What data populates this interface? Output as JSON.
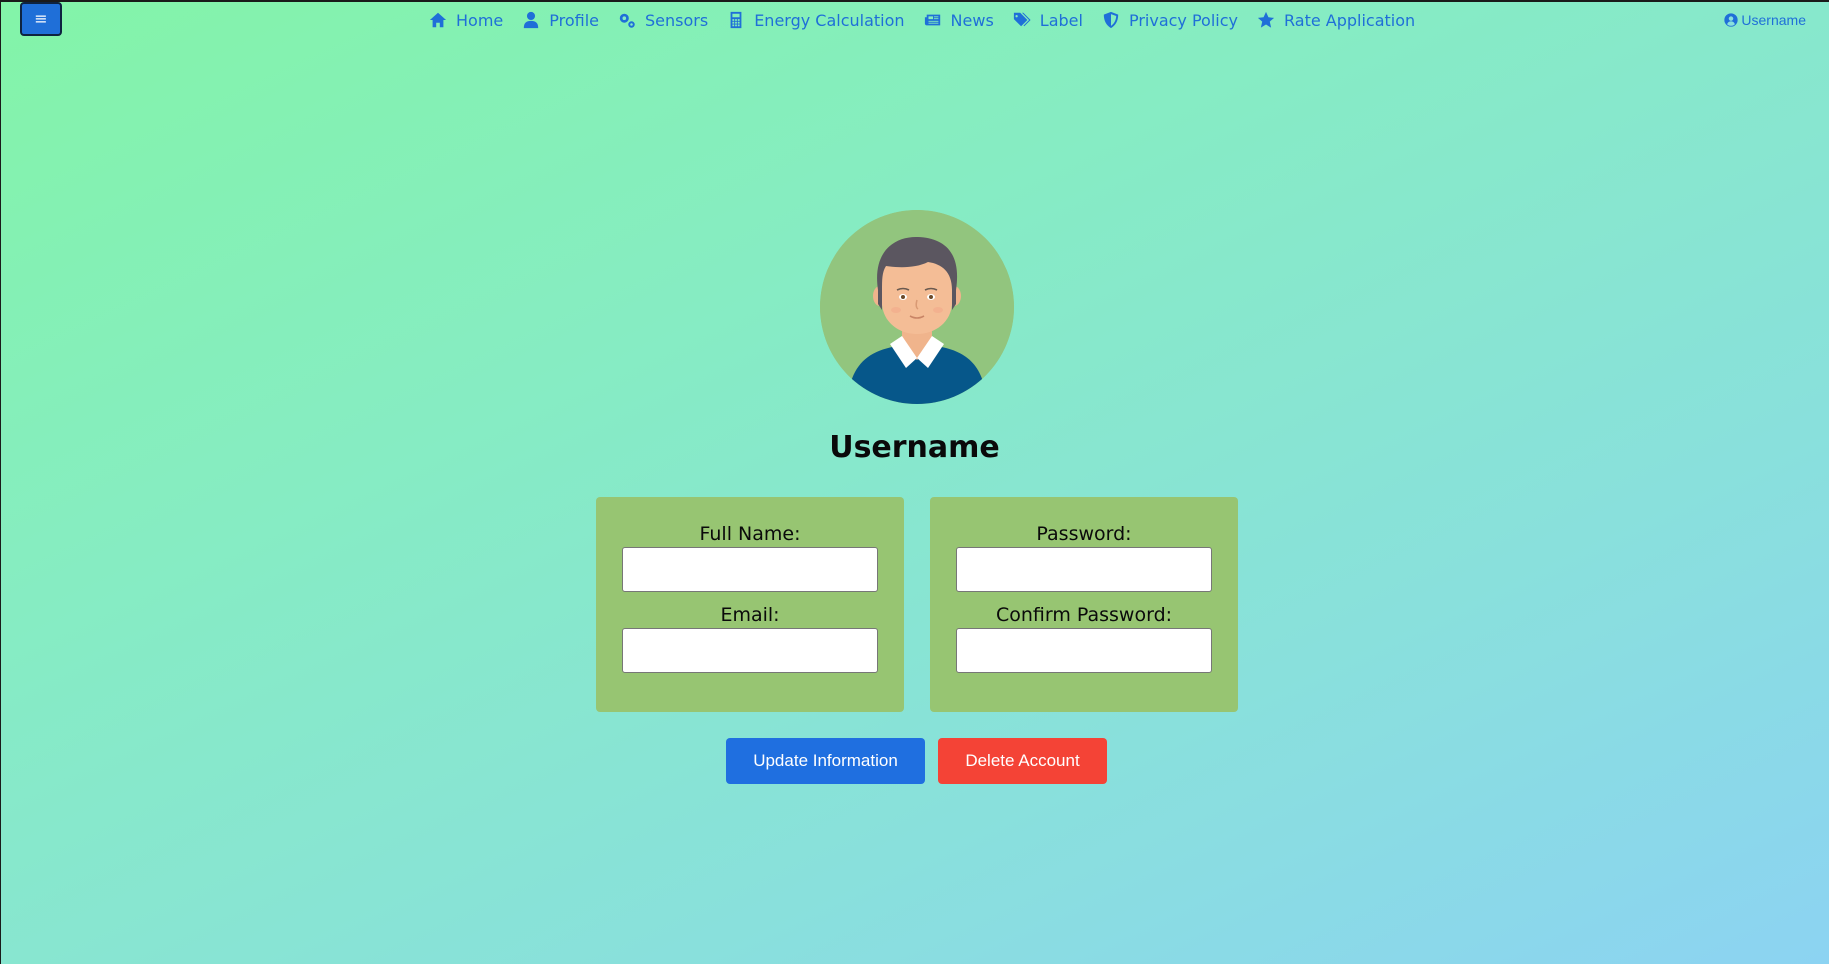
{
  "header": {
    "menu_toggle_icon": "hamburger-icon",
    "menu_toggle_glyph": "≡",
    "nav": [
      {
        "label": "Home",
        "icon": "home-icon"
      },
      {
        "label": "Profile",
        "icon": "user-icon"
      },
      {
        "label": "Sensors",
        "icon": "gears-icon"
      },
      {
        "label": "Energy Calculation",
        "icon": "calculator-icon"
      },
      {
        "label": "News",
        "icon": "newspaper-icon"
      },
      {
        "label": "Label",
        "icon": "tags-icon"
      },
      {
        "label": "Privacy Policy",
        "icon": "shield-icon"
      },
      {
        "label": "Rate Application",
        "icon": "star-icon"
      }
    ],
    "user_link": {
      "label": "Username",
      "icon": "user-circle-icon"
    }
  },
  "profile": {
    "avatar_icon": "avatar-illustration",
    "name": "Username"
  },
  "form": {
    "full_name": {
      "label": "Full Name:",
      "value": ""
    },
    "email": {
      "label": "Email:",
      "value": ""
    },
    "password": {
      "label": "Password:",
      "value": ""
    },
    "confirm_password": {
      "label": "Confirm Password:",
      "value": ""
    }
  },
  "actions": {
    "update_label": "Update Information",
    "delete_label": "Delete Account"
  },
  "colors": {
    "accent": "#1f6fd8",
    "danger": "#f44336",
    "card": "#97c572",
    "avatar_bg": "#92c57e"
  }
}
